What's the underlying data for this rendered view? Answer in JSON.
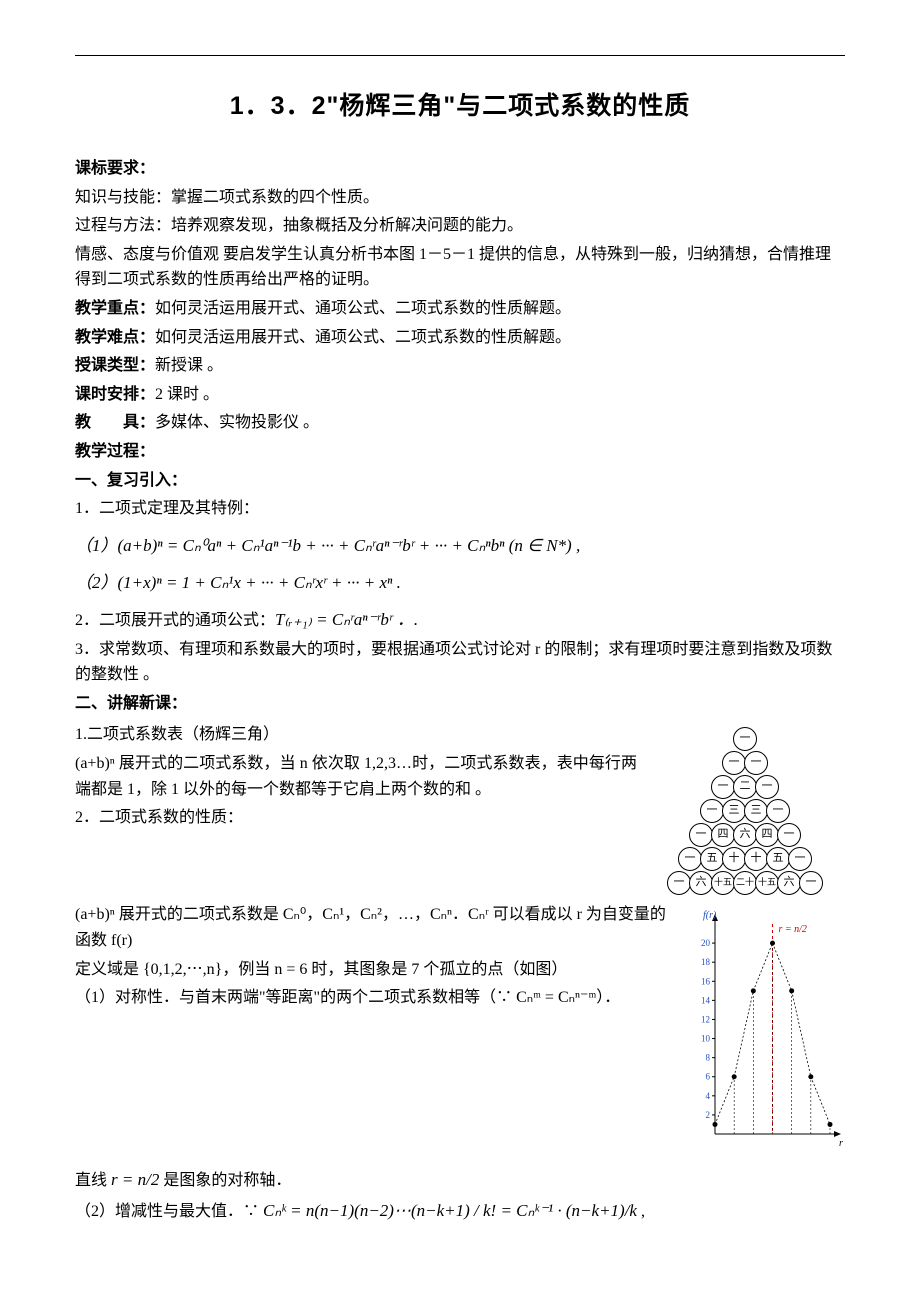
{
  "title": "1．3．2\"杨辉三角\"与二项式系数的性质",
  "h1": "课标要求：",
  "p1": "知识与技能：掌握二项式系数的四个性质。",
  "p2": "过程与方法：培养观察发现，抽象概括及分析解决问题的能力。",
  "p3": "情感、态度与价值观 要启发学生认真分析书本图 1－5－1 提供的信息，从特殊到一般，归纳猜想，合情推理得到二项式系数的性质再给出严格的证明。",
  "l4a": "教学重点：",
  "l4b": "如何灵活运用展开式、通项公式、二项式系数的性质解题。",
  "l5a": "教学难点：",
  "l5b": "如何灵活运用展开式、通项公式、二项式系数的性质解题。",
  "l6a": "授课类型：",
  "l6b": "新授课 。",
  "l7a": "课时安排：",
  "l7b": "2 课时 。",
  "l8a": "教　　具：",
  "l8b": "多媒体、实物投影仪 。",
  "l9": "教学过程：",
  "l10": "一、复习引入：",
  "l11": "1．二项式定理及其特例：",
  "f1": "（1）(a+b)ⁿ = Cₙ⁰aⁿ + Cₙ¹aⁿ⁻¹b + ··· + Cₙʳaⁿ⁻ʳbʳ + ··· + Cₙⁿbⁿ (n ∈ N*) ,",
  "f2": "（2）(1+x)ⁿ = 1 + Cₙ¹x + ··· + Cₙʳxʳ + ··· + xⁿ .",
  "l12pre": "2．二项展开式的通项公式：",
  "f3": "T₍ᵣ₊₁₎ = Cₙʳaⁿ⁻ʳbʳ ．.",
  "l13": "3．求常数项、有理项和系数最大的项时，要根据通项公式讨论对 r 的限制；求有理项时要注意到指数及项数的整数性 。",
  "l14": "二、讲解新课：",
  "l15": "1.二项式系数表（杨辉三角）",
  "l16": "(a+b)ⁿ 展开式的二项式系数，当 n 依次取 1,2,3…时，二项式系数表，表中每行两端都是 1，除 1 以外的每一个数都等于它肩上两个数的和 。",
  "l17": "2．二项式系数的性质：",
  "l18": "(a+b)ⁿ 展开式的二项式系数是 Cₙ⁰，Cₙ¹，Cₙ²，…，Cₙⁿ．Cₙʳ 可以看成以 r 为自变量的函数 f(r)",
  "l19": "定义域是 {0,1,2,⋯,n}，例当 n = 6 时，其图象是 7 个孤立的点（如图）",
  "l20": "（1）对称性．与首末两端\"等距离\"的两个二项式系数相等（∵ Cₙᵐ = Cₙⁿ⁻ᵐ）．",
  "l21pre": "直线 ",
  "l21f": "r = n/2",
  "l21post": " 是图象的对称轴．",
  "l22pre": "（2）增减性与最大值．∵ ",
  "l22f": "Cₙᵏ = n(n−1)(n−2)⋯(n−k+1) / k! = Cₙᵏ⁻¹ · (n−k+1)/k",
  "l22post": " ,",
  "pascal": {
    "rows": [
      [
        "一"
      ],
      [
        "一",
        "一"
      ],
      [
        "一",
        "二",
        "一"
      ],
      [
        "一",
        "三",
        "三",
        "一"
      ],
      [
        "一",
        "四",
        "六",
        "四",
        "一"
      ],
      [
        "一",
        "五",
        "十",
        "十",
        "五",
        "一"
      ],
      [
        "一",
        "六",
        "十五",
        "二十",
        "十五",
        "六",
        "一"
      ]
    ]
  },
  "chart_data": {
    "type": "scatter",
    "title": "",
    "xlabel": "r",
    "ylabel": "f(r)",
    "x": [
      0,
      1,
      2,
      3,
      4,
      5,
      6
    ],
    "y": [
      1,
      6,
      15,
      20,
      15,
      6,
      1
    ],
    "yticks": [
      2,
      4,
      6,
      8,
      10,
      12,
      14,
      16,
      18,
      20
    ],
    "annotation": "r = n/2",
    "xlim": [
      0,
      6
    ],
    "ylim": [
      0,
      22
    ]
  }
}
